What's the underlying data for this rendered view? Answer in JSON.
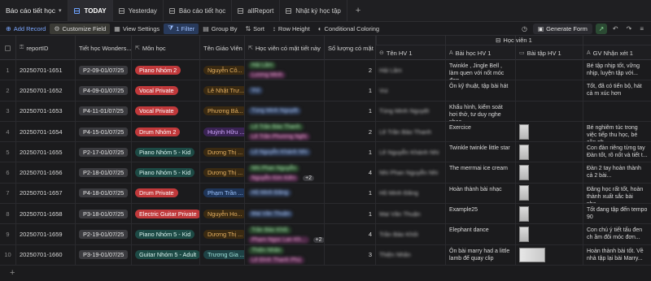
{
  "tabbar": {
    "base_title": "Báo cáo tiết học",
    "tabs": [
      {
        "label": "TODAY",
        "active": true
      },
      {
        "label": "Yesterday",
        "active": false
      },
      {
        "label": "Báo cáo tiết học",
        "active": false
      },
      {
        "label": "allReport",
        "active": false
      },
      {
        "label": "Nhật ký học tập",
        "active": false
      }
    ],
    "add_symbol": "+"
  },
  "toolbar": {
    "add_record": "Add Record",
    "customize_field": "Customize Field",
    "view_settings": "View Settings",
    "filter": "1 Filter",
    "group_by": "Group By",
    "sort": "Sort",
    "row_height": "Row Height",
    "conditional_coloring": "Conditional Coloring",
    "generate_form": "Generate Form"
  },
  "group_header": {
    "label": "Học viên 1"
  },
  "columns": [
    "reportID",
    "Tiết học Wonders...",
    "Môn học",
    "Tên Giáo Viên",
    "Học viên có mặt tiết này",
    "Số lượng có mặt",
    "Tên HV 1",
    "Bài học HV 1",
    "Bài tập HV 1",
    "GV Nhận xét 1"
  ],
  "rows": [
    {
      "no": "1",
      "id": "20250701-1651",
      "lesson": "P2-09-01/07/25",
      "subject": "Piano Nhóm 2",
      "subject_color": "red",
      "teacher": "Nguyễn Cô...",
      "teacher_color": "ppl",
      "students": [
        "Hải Lâm",
        "Lương Minh"
      ],
      "students_more": "",
      "count": "2",
      "hv1": "Hải Lâm",
      "lesson_hv1": "Twinkle , Jingle Bell , làm quen với nốt móc đơn",
      "hw": "",
      "comment": "Bé tập nhịp tốt, vững nhịp, luyện tập với..."
    },
    {
      "no": "2",
      "id": "20250701-1652",
      "lesson": "P4-09-01/07/25",
      "subject": "Vocal Private",
      "subject_color": "red",
      "teacher": "Lê Nhật Trư...",
      "teacher_color": "ppl",
      "students": [
        "Vui"
      ],
      "students_more": "",
      "count": "1",
      "hv1": "Vui",
      "lesson_hv1": "Ôn kỹ thuật, tập bài hát",
      "hw": "",
      "comment": "Tốt, đã có tiến bộ, hát cả m xúc hơn"
    },
    {
      "no": "3",
      "id": "20250701-1653",
      "lesson": "P4-11-01/07/25",
      "subject": "Vocal Private",
      "subject_color": "red",
      "teacher": "Phương Bả...",
      "teacher_color": "ppl",
      "students": [
        "Tùng Minh Nguyệt"
      ],
      "students_more": "",
      "count": "1",
      "hv1": "Tùng Minh Nguyệt",
      "lesson_hv1": "Khẩu hình, kiểm soát hơi thở, tư duy nghe nhạc",
      "hw": "",
      "comment": ""
    },
    {
      "no": "4",
      "id": "20250701-1654",
      "lesson": "P4-15-01/07/25",
      "subject": "Drum Nhóm 2",
      "subject_color": "red",
      "teacher": "Huỳnh Hữu ...",
      "teacher_color": "purple",
      "students": [
        "Lê Trần Bảo Thanh",
        "Lê Trần Phương Nghi"
      ],
      "students_more": "",
      "count": "2",
      "hv1": "Lê Trần Bảo Thanh",
      "lesson_hv1": "Exercice",
      "hw": "thumb",
      "comment": "Bé nghiêm túc trong việc tiếp thu học, bé cần ph..."
    },
    {
      "no": "5",
      "id": "20250701-1655",
      "lesson": "P2-17-01/07/25",
      "subject": "Piano Nhóm 5 - Kid",
      "subject_color": "teal",
      "teacher": "Dương Thị ...",
      "teacher_color": "ppl",
      "students": [
        "Lê Nguyễn Khánh Nhi"
      ],
      "students_more": "",
      "count": "1",
      "hv1": "Lê Nguyễn Khánh Nhi",
      "lesson_hv1": "Twinkle twinkle little star",
      "hw": "thumb",
      "comment": "Con đàn riêng từng tay Đàn tốt, rõ nốt và tiết t..."
    },
    {
      "no": "6",
      "id": "20250701-1656",
      "lesson": "P2-18-01/07/25",
      "subject": "Piano Nhóm 5 - Kid",
      "subject_color": "teal",
      "teacher": "Dương Thị ...",
      "teacher_color": "ppl",
      "students": [
        "Nhi Phan Nguyễn",
        "Nguyễn Kim Kiên"
      ],
      "students_more": "+2",
      "count": "4",
      "hv1": "Nhi Phan Nguyễn Nhi",
      "lesson_hv1": "The merrmai ice cream",
      "hw": "thumb",
      "comment": "Đàn 2 tay hoàn thành cả 2 bài..."
    },
    {
      "no": "7",
      "id": "20250701-1657",
      "lesson": "P4-18-01/07/25",
      "subject": "Drum Private",
      "subject_color": "red",
      "teacher": "Phạm Trần ...",
      "teacher_color": "blue",
      "students": [
        "Hồ Minh Đăng"
      ],
      "students_more": "",
      "count": "1",
      "hv1": "Hồ Minh Đăng",
      "lesson_hv1": "Hoàn thành bài nhạc",
      "hw": "thumb",
      "comment": "Đăng học rất tốt, hoàn thành xuất sắc bài nhạ..."
    },
    {
      "no": "8",
      "id": "20250701-1658",
      "lesson": "P3-18-01/07/25",
      "subject": "Electric Guitar Private",
      "subject_color": "red",
      "teacher": "Nguyễn Ho...",
      "teacher_color": "ppl",
      "students": [
        "Mai Văn Thuận"
      ],
      "students_more": "",
      "count": "1",
      "hv1": "Mai Văn Thuận",
      "lesson_hv1": "Example25",
      "hw": "thumb",
      "comment": "Tốt đang tập đến tempo 90"
    },
    {
      "no": "9",
      "id": "20250701-1659",
      "lesson": "P2-19-01/07/25",
      "subject": "Piano Nhóm 5 - Kid",
      "subject_color": "teal",
      "teacher": "Dương Thị ...",
      "teacher_color": "ppl",
      "students": [
        "Trần Bảo Khôi",
        "Phạm Ngọc Lan Kh..."
      ],
      "students_more": "+2",
      "count": "4",
      "hv1": "Trần Bảo Khôi",
      "lesson_hv1": "Elephant dance",
      "hw": "thumb",
      "comment": "Con chú ý tiết tấu đen ch ầm đôi móc đơn..."
    },
    {
      "no": "10",
      "id": "20250701-1660",
      "lesson": "P3-19-01/07/25",
      "subject": "Guitar Nhóm 5 - Adult",
      "subject_color": "teal",
      "teacher": "Trương Gia ...",
      "teacher_color": "teal2",
      "students": [
        "Thiện Nhân",
        "Lê Đình Thanh Phú"
      ],
      "students_more": "",
      "count": "3",
      "hv1": "Thiện Nhân",
      "lesson_hv1": "Ôn bài marry had a little lamb để quay clip",
      "hw": "wide",
      "comment": "Hoàn thành bài tốt. Về nhà tập lại bài Marry..."
    }
  ],
  "add_row_symbol": "+"
}
